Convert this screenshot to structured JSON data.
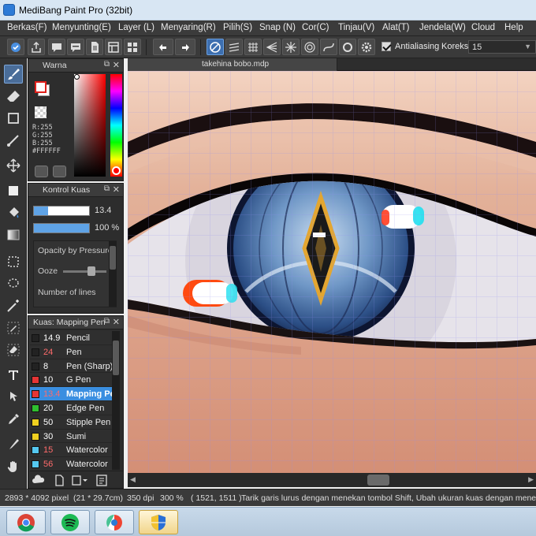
{
  "window": {
    "title": "MediBang Paint Pro (32bit)"
  },
  "menu": [
    "Berkas(F)",
    "Menyunting(E)",
    "Layer (L)",
    "Menyaring(R)",
    "Pilih(S)",
    "Snap (N)",
    "Cor(C)",
    "Tinjau(V)",
    "Alat(T)",
    "Jendela(W)",
    "Cloud",
    "Help"
  ],
  "toolbar": {
    "antialias_label": "Antialiasing",
    "antialias_checked": true,
    "correction_label": "Koreksi",
    "correction_value": "15"
  },
  "tools": [
    "brush-icon",
    "eraser-icon",
    "rectangle-icon",
    "line-icon",
    "move-icon",
    "fill-rect-icon",
    "bucket-icon",
    "gradient-icon",
    "select-icon",
    "lasso-icon",
    "magic-wand-icon",
    "selection-pen-icon",
    "selection-eraser-icon",
    "text-icon",
    "divide-icon",
    "eyedropper-icon",
    "hand-icon"
  ],
  "color_panel": {
    "title": "Warna",
    "r": "R:255",
    "g": "G:255",
    "b": "B:255",
    "hex": "#FFFFFF",
    "primary_color": "#ffffff",
    "primary_border": "#e0201b"
  },
  "brush_control": {
    "title": "Kontrol Kuas",
    "size": "13.4",
    "opacity": "100 %",
    "size_fraction": 0.25,
    "opacity_fraction": 1.0,
    "options": [
      "Opacity by Pressure",
      "Ooze",
      "Number of lines"
    ]
  },
  "brush_list": {
    "title": "Kuas: Mapping Pen",
    "items": [
      {
        "size": "14.9",
        "name": "Pencil",
        "color": "#222222",
        "size_color": "#ffffff"
      },
      {
        "size": "24",
        "name": "Pen",
        "color": "#222222",
        "size_color": "#ff6b6b"
      },
      {
        "size": "8",
        "name": "Pen (Sharp)",
        "color": "#222222",
        "size_color": "#ffffff"
      },
      {
        "size": "10",
        "name": "G Pen",
        "color": "#e53535",
        "size_color": "#ffffff"
      },
      {
        "size": "13.4",
        "name": "Mapping Pen",
        "color": "#e53535",
        "size_color": "#ff6b6b",
        "selected": true
      },
      {
        "size": "20",
        "name": "Edge Pen",
        "color": "#2fbf2f",
        "size_color": "#ffffff"
      },
      {
        "size": "50",
        "name": "Stipple Pen",
        "color": "#f0d020",
        "size_color": "#ffffff"
      },
      {
        "size": "30",
        "name": "Sumi",
        "color": "#f0d020",
        "size_color": "#ffffff"
      },
      {
        "size": "15",
        "name": "Watercolor",
        "color": "#55c8f0",
        "size_color": "#ff6b6b"
      },
      {
        "size": "56",
        "name": "Watercolor",
        "color": "#55c8f0",
        "size_color": "#ff6b6b"
      }
    ]
  },
  "document": {
    "tab": "takehina bobo.mdp"
  },
  "status": {
    "size_px": "2893 * 4092 pixel",
    "size_cm": "(21 * 29.7cm)",
    "dpi": "350 dpi",
    "zoom": "300 %",
    "coords": "( 1521, 1511 )",
    "hint": "Tarik garis lurus dengan menekan tombol Shift, Ubah ukuran kuas dengan menekan"
  },
  "taskbar": [
    "chrome-icon",
    "spotify-icon",
    "medibang-icon",
    "shield-icon"
  ]
}
